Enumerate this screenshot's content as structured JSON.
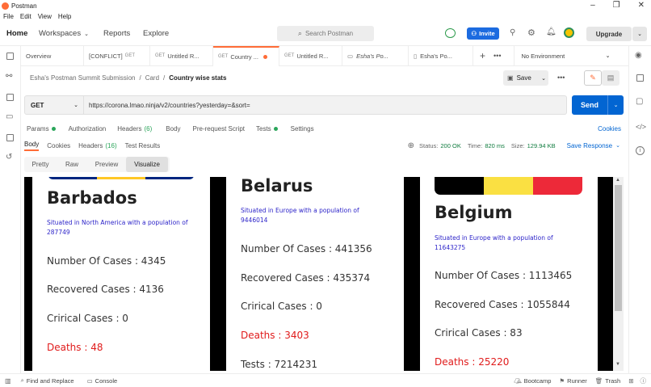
{
  "app": {
    "title": "Postman"
  },
  "menu": [
    "File",
    "Edit",
    "View",
    "Help"
  ],
  "header": {
    "home": "Home",
    "workspaces": "Workspaces",
    "reports": "Reports",
    "explore": "Explore",
    "search_placeholder": "Search Postman",
    "invite": "Invite",
    "upgrade": "Upgrade"
  },
  "tabs": [
    {
      "method": "",
      "label": "Overview"
    },
    {
      "method": "GET",
      "label": "[CONFLICT]"
    },
    {
      "method": "GET",
      "label": "Untitled R..."
    },
    {
      "method": "GET",
      "label": "Country ..."
    },
    {
      "method": "GET",
      "label": "Untitled R..."
    },
    {
      "method": "",
      "label": "Esha's Po..."
    },
    {
      "method": "",
      "label": "Esha's Po..."
    }
  ],
  "environment": "No Environment",
  "breadcrumb": [
    "Esha's Postman Summit Submission",
    "Card",
    "Country wise stats"
  ],
  "save_label": "Save",
  "request": {
    "method": "GET",
    "url": "https://corona.lmao.ninja/v2/countries?yesterday=&sort=",
    "send": "Send"
  },
  "req_tabs": {
    "params": "Params",
    "authorization": "Authorization",
    "headers": "Headers",
    "headers_count": "(6)",
    "body": "Body",
    "prerequest": "Pre-request Script",
    "tests": "Tests",
    "settings": "Settings",
    "cookies": "Cookies"
  },
  "resp_tabs": {
    "body": "Body",
    "cookies": "Cookies",
    "headers": "Headers",
    "headers_count": "(16)",
    "test_results": "Test Results",
    "status_label": "Status:",
    "status": "200 OK",
    "time_label": "Time:",
    "time": "820 ms",
    "size_label": "Size:",
    "size": "129.94 KB",
    "save_response": "Save Response"
  },
  "view_tabs": [
    "Pretty",
    "Raw",
    "Preview",
    "Visualize"
  ],
  "cards": [
    {
      "name": "Barbados",
      "situated": "Situated in North America with a population of 287749",
      "cases": "Number Of Cases : 4345",
      "recovered": "Recovered Cases : 4136",
      "critical": "Crirical Cases : 0",
      "deaths": "Deaths : 48",
      "flag_colors": [
        "#00267f",
        "#ffc726",
        "#00267f"
      ]
    },
    {
      "name": "Belarus",
      "situated": "Situated in Europe with a population of 9446014",
      "cases": "Number Of Cases : 441356",
      "recovered": "Recovered Cases : 435374",
      "critical": "Crirical Cases : 0",
      "deaths": "Deaths : 3403",
      "tests": "Tests : 7214231"
    },
    {
      "name": "Belgium",
      "situated": "Situated in Europe with a population of 11643275",
      "cases": "Number Of Cases : 1113465",
      "recovered": "Recovered Cases : 1055844",
      "critical": "Crirical Cases : 83",
      "deaths": "Deaths : 25220",
      "flag_colors": [
        "#000000",
        "#fae042",
        "#ed2939"
      ]
    }
  ],
  "statusbar": {
    "find_replace": "Find and Replace",
    "console": "Console",
    "bootcamp": "Bootcamp",
    "runner": "Runner",
    "trash": "Trash"
  },
  "colors": {
    "accent": "#ff6c37",
    "send": "#0265d2",
    "death": "#e01b1b",
    "situated": "#2d24c9",
    "status_ok": "#0f7b3e"
  }
}
